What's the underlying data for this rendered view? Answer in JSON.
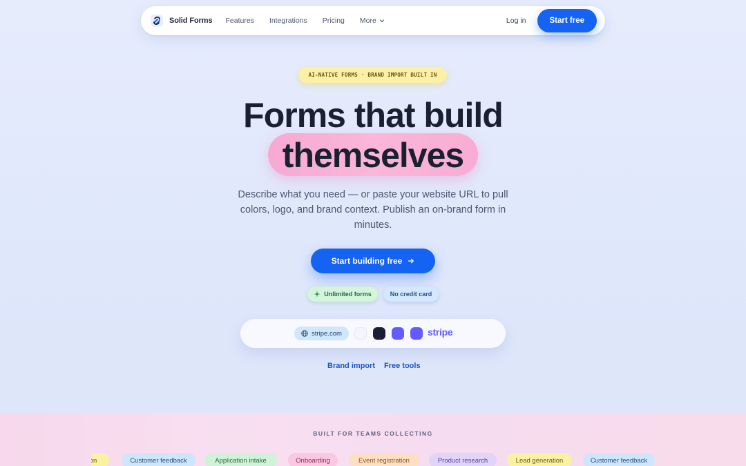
{
  "nav": {
    "brand": "Solid Forms",
    "links": [
      "Features",
      "Integrations",
      "Pricing",
      "More"
    ],
    "login": "Log in",
    "cta": "Start free"
  },
  "hero": {
    "badge": "AI-NATIVE FORMS · BRAND IMPORT BUILT IN",
    "title_line1": "Forms that build",
    "title_line2": "themselves",
    "subtitle": "Describe what you need — or paste your website URL to pull colors, logo, and brand context. Publish an on-brand form in minutes.",
    "cta": "Start building free",
    "chips": [
      "Unlimited forms",
      "No credit card"
    ]
  },
  "brand_import": {
    "url": "stripe.com",
    "swatch_colors": [
      "#f4f6fc",
      "#1a1f36",
      "#635bff",
      "#635bff"
    ],
    "logo_text": "stripe"
  },
  "links": [
    "Brand import",
    "Free tools"
  ],
  "teams": {
    "title": "BUILT FOR TEAMS COLLECTING",
    "tags": [
      {
        "label": "ation",
        "bg": "#fbf1a2",
        "fg": "#6b5a14"
      },
      {
        "label": "Customer feedback",
        "bg": "#cde6fb",
        "fg": "#27507f"
      },
      {
        "label": "Application intake",
        "bg": "#cff3d8",
        "fg": "#2a6a3f"
      },
      {
        "label": "Onboarding",
        "bg": "#fbc7e2",
        "fg": "#8a2b5e"
      },
      {
        "label": "Event registration",
        "bg": "#fde0c4",
        "fg": "#8a5420"
      },
      {
        "label": "Product research",
        "bg": "#e0d4fb",
        "fg": "#5a3c9a"
      },
      {
        "label": "Lead generation",
        "bg": "#fbf1a2",
        "fg": "#6b5a14"
      },
      {
        "label": "Customer feedback",
        "bg": "#cde6fb",
        "fg": "#27507f"
      }
    ]
  }
}
